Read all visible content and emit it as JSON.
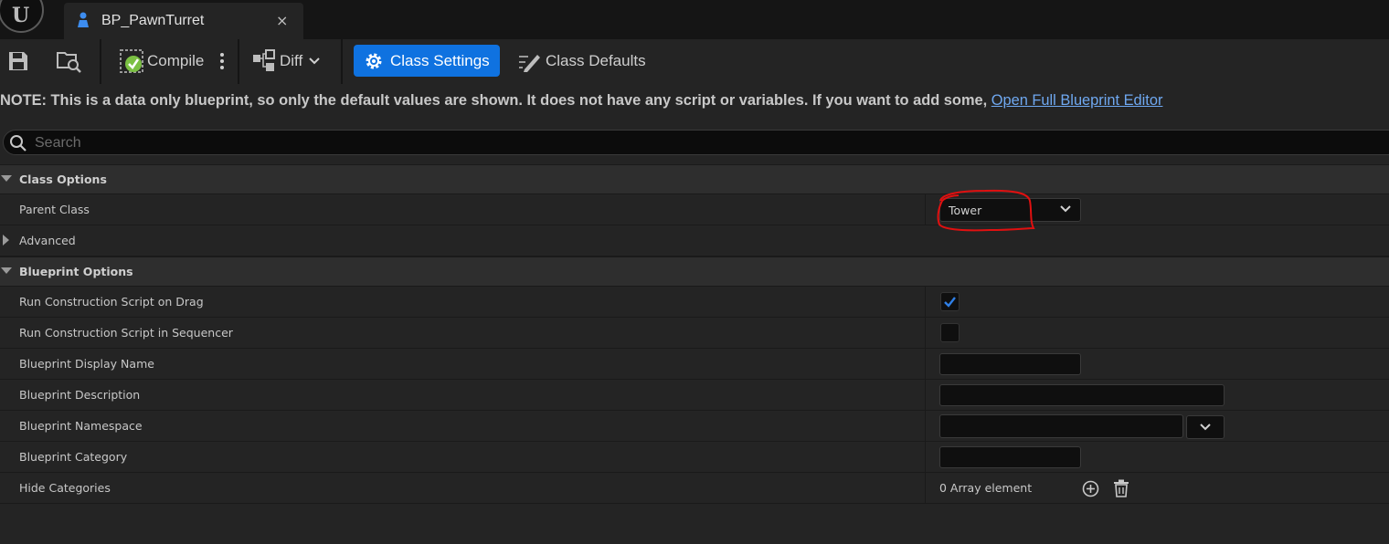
{
  "window": {
    "tab_title": "BP_PawnTurret",
    "tab_close": "×"
  },
  "toolbar": {
    "compile_label": "Compile",
    "diff_label": "Diff",
    "class_settings_label": "Class Settings",
    "class_defaults_label": "Class Defaults"
  },
  "notice": {
    "text": "NOTE: This is a data only blueprint, so only the default values are shown.  It does not have any script or variables.  If you want to add some, ",
    "link": "Open Full Blueprint Editor"
  },
  "search": {
    "placeholder": "Search"
  },
  "details": {
    "class_options": {
      "title": "Class Options",
      "parent_class_label": "Parent Class",
      "parent_class_value": "Tower",
      "advanced_label": "Advanced"
    },
    "blueprint_options": {
      "title": "Blueprint Options",
      "run_on_drag_label": "Run Construction Script on Drag",
      "run_on_drag_checked": true,
      "run_in_sequencer_label": "Run Construction Script in Sequencer",
      "run_in_sequencer_checked": false,
      "display_name_label": "Blueprint Display Name",
      "display_name_value": "",
      "description_label": "Blueprint Description",
      "description_value": "",
      "namespace_label": "Blueprint Namespace",
      "namespace_value": "",
      "category_label": "Blueprint Category",
      "category_value": "",
      "hide_categories_label": "Hide Categories",
      "hide_categories_value": "0 Array element"
    }
  },
  "colors": {
    "accent": "#0f72e0",
    "annotation": "#e01010",
    "background": "#242424"
  }
}
